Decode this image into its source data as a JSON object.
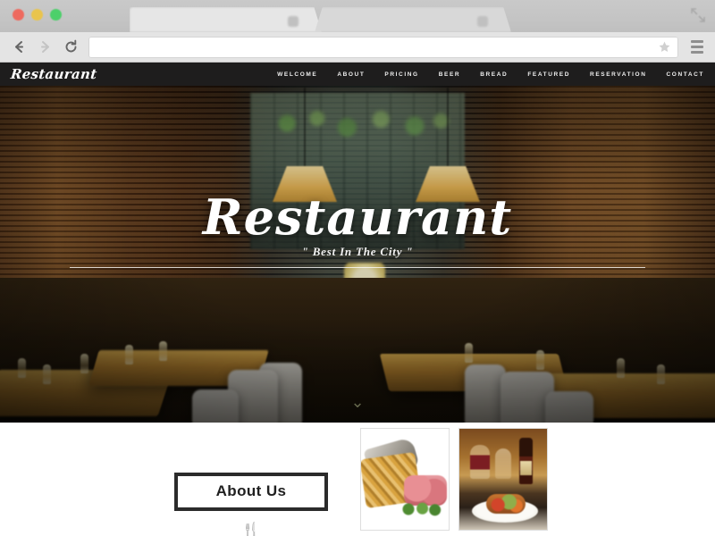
{
  "browser": {
    "traffic_lights": [
      {
        "name": "close",
        "color": "#ee6a5f"
      },
      {
        "name": "minimize",
        "color": "#e9c44d"
      },
      {
        "name": "maximize",
        "color": "#4cd06a"
      }
    ],
    "tabs": [
      {
        "title": ""
      },
      {
        "title": ""
      }
    ],
    "back_icon": "back-arrow-icon",
    "forward_icon": "forward-arrow-icon",
    "reload_icon": "reload-icon",
    "bookmark_icon": "star-icon",
    "menu_icon": "hamburger-menu-icon",
    "resize_icon": "expand-arrows-icon",
    "address_value": "",
    "address_placeholder": ""
  },
  "site": {
    "logo": "Restaurant",
    "nav": [
      {
        "label": "WELCOME"
      },
      {
        "label": "ABOUT"
      },
      {
        "label": "PRICING"
      },
      {
        "label": "BEER"
      },
      {
        "label": "BREAD"
      },
      {
        "label": "FEATURED"
      },
      {
        "label": "RESERVATION"
      },
      {
        "label": "CONTACT"
      }
    ],
    "nav_background": "#1e1d1d",
    "nav_text_color": "#efefef"
  },
  "hero": {
    "title": "Restaurant",
    "subtitle": "\" Best In The City \"",
    "scroll_indicator": "⌄",
    "image_description": "Dimly lit restaurant interior with wooden tables, white chairs, pendant lamps and wine glasses"
  },
  "about": {
    "heading": "About Us",
    "utensil_icon": "🍴",
    "images": [
      {
        "name": "food-photo-fries-and-cured-meat",
        "alt": "Basket of fries with cured meat and greens on a white plate"
      },
      {
        "name": "food-photo-wine-and-plated-dish",
        "alt": "Red wine bottle and glasses beside a plated gourmet dish"
      }
    ]
  }
}
